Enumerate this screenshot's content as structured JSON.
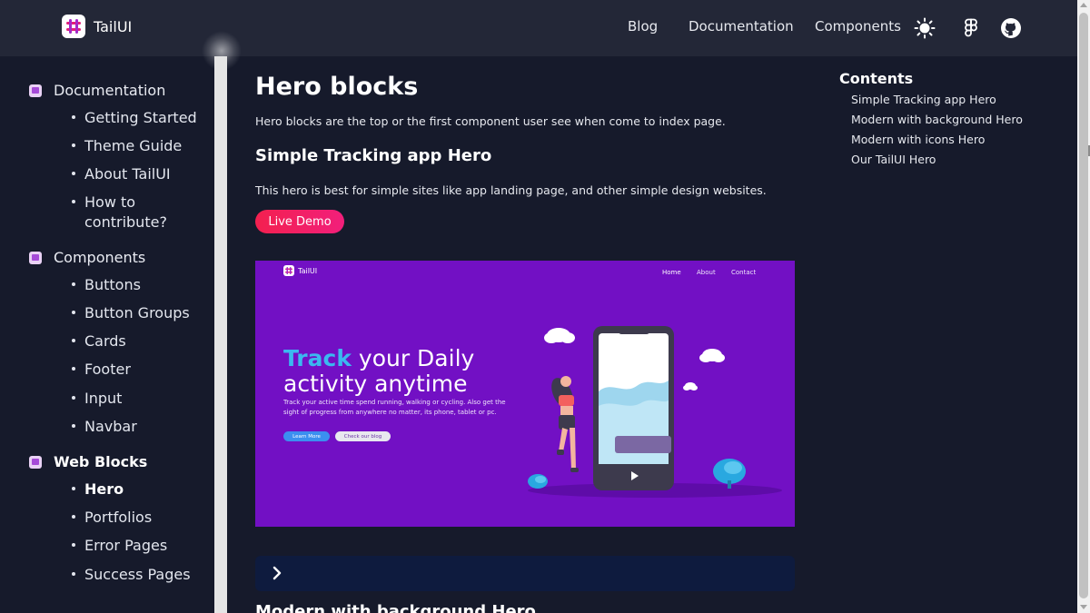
{
  "header": {
    "brand": "TailUI",
    "nav": {
      "blog": "Blog",
      "documentation": "Documentation",
      "components": "Components"
    },
    "icons": [
      "sun-icon",
      "figma-icon",
      "github-icon"
    ]
  },
  "sidebar": {
    "sections": [
      {
        "label": "Documentation",
        "icon": "book-icon",
        "items": [
          "Getting Started",
          "Theme Guide",
          "About TailUI",
          "How to contribute?"
        ]
      },
      {
        "label": "Components",
        "icon": "cube-icon",
        "items": [
          "Buttons",
          "Button Groups",
          "Cards",
          "Footer",
          "Input",
          "Navbar"
        ]
      },
      {
        "label": "Web Blocks",
        "icon": "blocks-icon",
        "items": [
          "Hero",
          "Portfolios",
          "Error Pages",
          "Success Pages"
        ]
      }
    ],
    "active_item": "Hero"
  },
  "main": {
    "title": "Hero blocks",
    "description": "Hero blocks are the top or the first component user see when come to index page.",
    "section_title": "Simple Tracking app Hero",
    "section_description": "This hero is best for simple sites like app landing page, and other simple design websites.",
    "live_demo": "Live Demo",
    "next_section_title": "Modern with background Hero"
  },
  "preview": {
    "brand": "TailUI",
    "nav": {
      "home": "Home",
      "about": "About",
      "contact": "Contact"
    },
    "headline_accent": "Track",
    "headline_rest": " your Daily activity anytime",
    "text": "Track your active time spend running, walking or cycling. Also get the sight of progress from anywhere no matter, its phone, tablet or pc.",
    "btn_primary": "Learn More",
    "btn_secondary": "Check our blog"
  },
  "toc": {
    "title": "Contents",
    "items": [
      "Simple Tracking app Hero",
      "Modern with background Hero",
      "Modern with icons Hero",
      "Our TailUI Hero"
    ]
  },
  "colors": {
    "background": "#161a2b",
    "topbar": "#232737",
    "accent_pink": "#f3204f",
    "preview_purple": "#7210c4",
    "preview_accent": "#3bb8f0"
  }
}
